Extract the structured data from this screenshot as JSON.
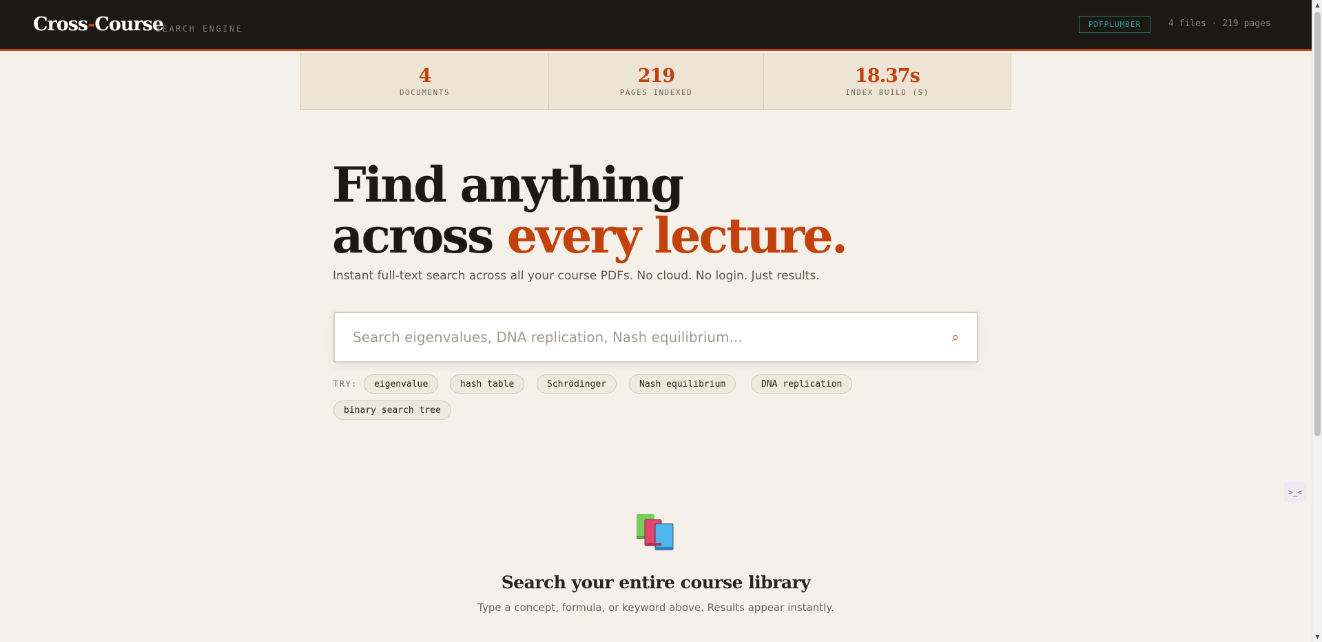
{
  "header": {
    "brand_part1": "Cross",
    "brand_dash": "-",
    "brand_part2": "Course",
    "subtitle": "SEARCH ENGINE",
    "engine_badge": "PDFPLUMBER",
    "file_summary": "4 files · 219 pages"
  },
  "stats": [
    {
      "value": "4",
      "label": "DOCUMENTS"
    },
    {
      "value": "219",
      "label": "PAGES INDEXED"
    },
    {
      "value": "18.37s",
      "label": "INDEX BUILD (S)"
    }
  ],
  "hero": {
    "title_line1": "Find anything",
    "title_line2_plain": "across ",
    "title_line2_accent": "every lecture.",
    "subtitle": "Instant full-text search across all your course PDFs. No cloud. No login. Just results."
  },
  "search": {
    "placeholder": "Search eigenvalues, DNA replication, Nash equilibrium...",
    "value": "",
    "icon": "search-icon"
  },
  "suggestions": {
    "label": "TRY:",
    "chips": [
      "eigenvalue",
      "hash table",
      "Schrödinger",
      "Nash equilibrium",
      "DNA replication",
      "binary search tree"
    ]
  },
  "empty_state": {
    "icon": "books-icon",
    "title": "Search your entire course library",
    "subtitle": "Type a concept, formula, or keyword above. Results appear instantly."
  },
  "side_widget": {
    "label": ">_<"
  },
  "colors": {
    "accent": "#c2410c",
    "header_bg": "#1c1814",
    "page_bg": "#f5f1ea",
    "badge_teal": "#2a9d94"
  }
}
